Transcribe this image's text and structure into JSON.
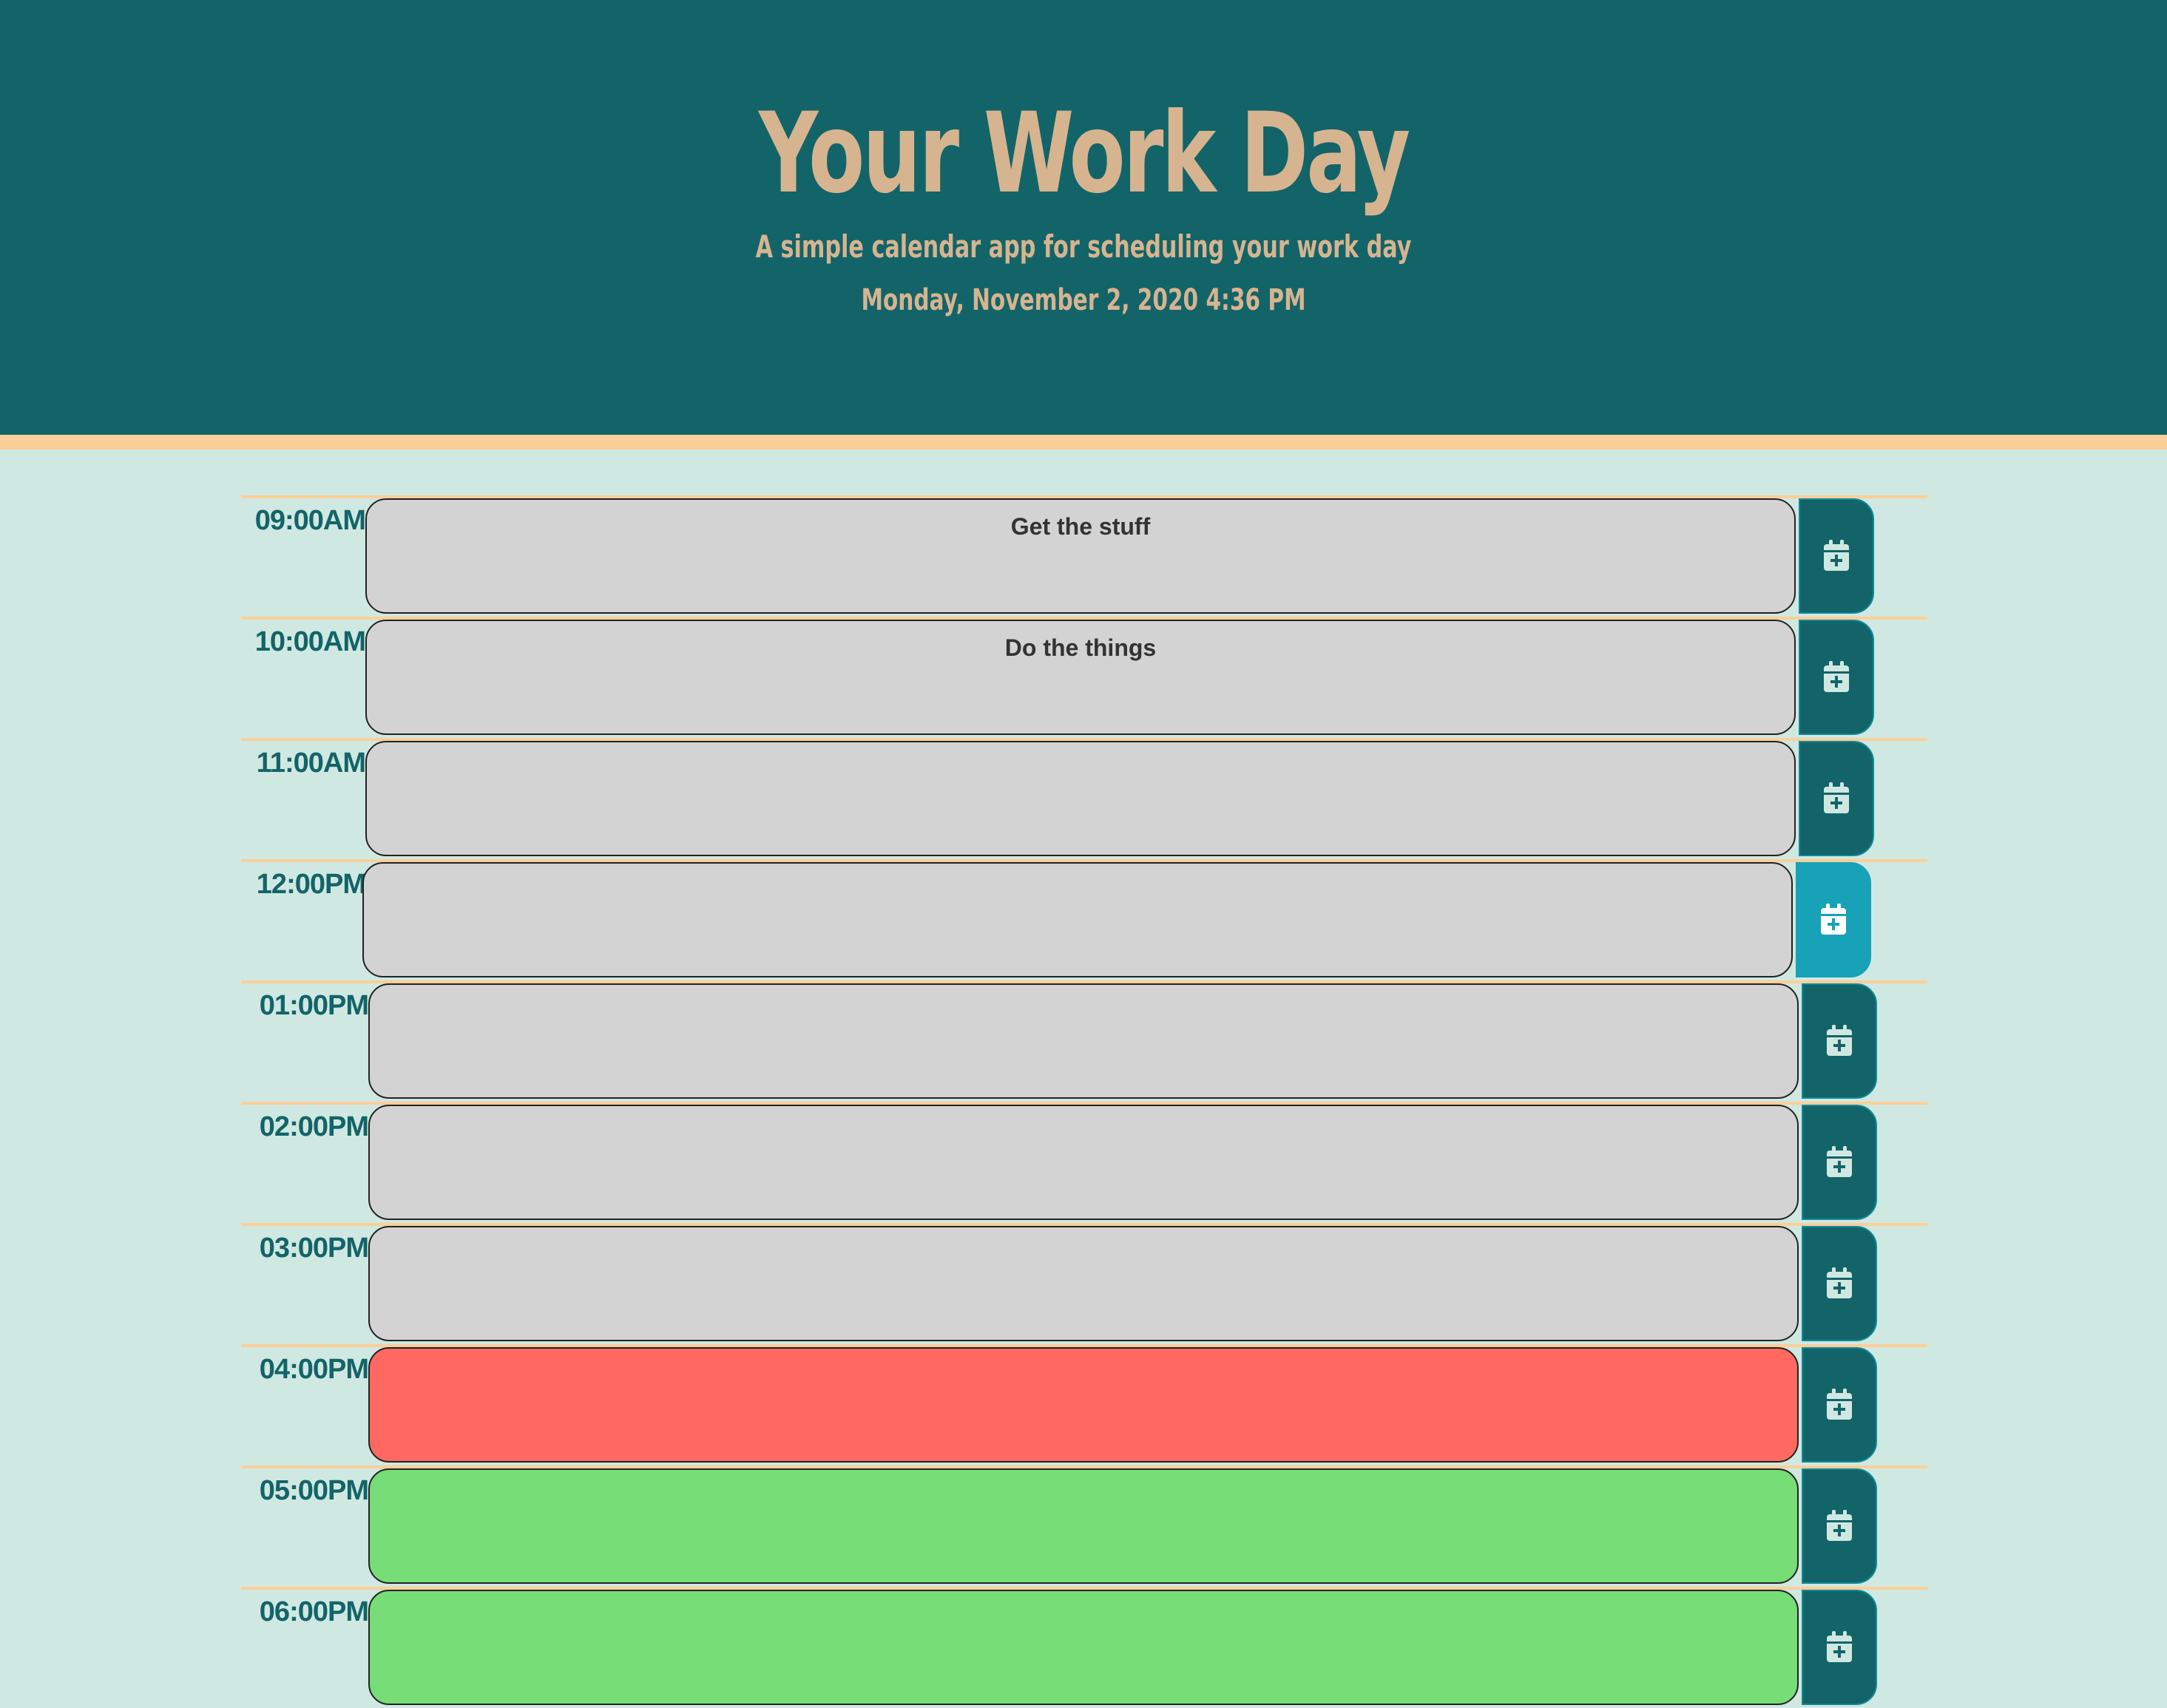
{
  "header": {
    "title": "Your Work Day",
    "subtitle": "A simple calendar app for scheduling your work day",
    "current_datetime": "Monday, November 2, 2020 4:36 PM"
  },
  "colors": {
    "header_bg": "#136468",
    "header_text": "#d6b490",
    "accent_border": "#fbcf98",
    "page_bg": "#d0e8e2",
    "past": "#d3d3d3",
    "present": "#ff6961",
    "future": "#77dd77",
    "save_button": "#136468",
    "save_button_active": "#17a2b8"
  },
  "time_blocks": [
    {
      "hour": "09:00AM",
      "text": "Get the stuff",
      "state": "past"
    },
    {
      "hour": "10:00AM",
      "text": "Do the things",
      "state": "past"
    },
    {
      "hour": "11:00AM",
      "text": "",
      "state": "past"
    },
    {
      "hour": "12:00PM",
      "text": "",
      "state": "past"
    },
    {
      "hour": "01:00PM",
      "text": "",
      "state": "past"
    },
    {
      "hour": "02:00PM",
      "text": "",
      "state": "past"
    },
    {
      "hour": "03:00PM",
      "text": "",
      "state": "past"
    },
    {
      "hour": "04:00PM",
      "text": "",
      "state": "present"
    },
    {
      "hour": "05:00PM",
      "text": "",
      "state": "future"
    },
    {
      "hour": "06:00PM",
      "text": "",
      "state": "future"
    }
  ],
  "save_icon": "calendar-plus-icon"
}
